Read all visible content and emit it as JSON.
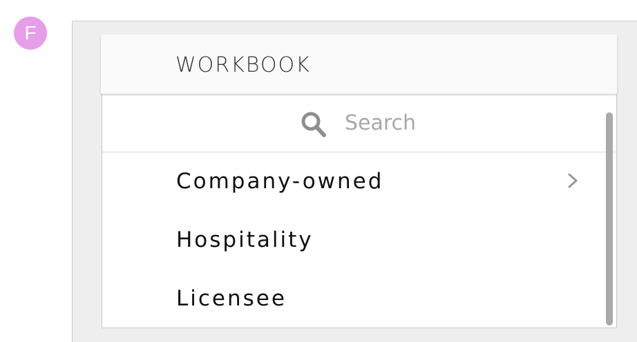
{
  "badge": {
    "letter": "F",
    "color": "#e79ee9"
  },
  "panel": {
    "title": "WORKBOOK",
    "search": {
      "placeholder": "Search",
      "value": "",
      "icon": "search-icon"
    },
    "items": [
      {
        "label": "Company-owned",
        "has_submenu": true,
        "icon": "chevron-right-icon"
      },
      {
        "label": "Hospitality",
        "has_submenu": false
      },
      {
        "label": "Licensee",
        "has_submenu": false
      }
    ]
  },
  "colors": {
    "background": "#eeeeee",
    "header": "#fafafa",
    "text": "#111111",
    "muted": "#a8a8a8",
    "scrollbar": "#a9a9a9"
  }
}
